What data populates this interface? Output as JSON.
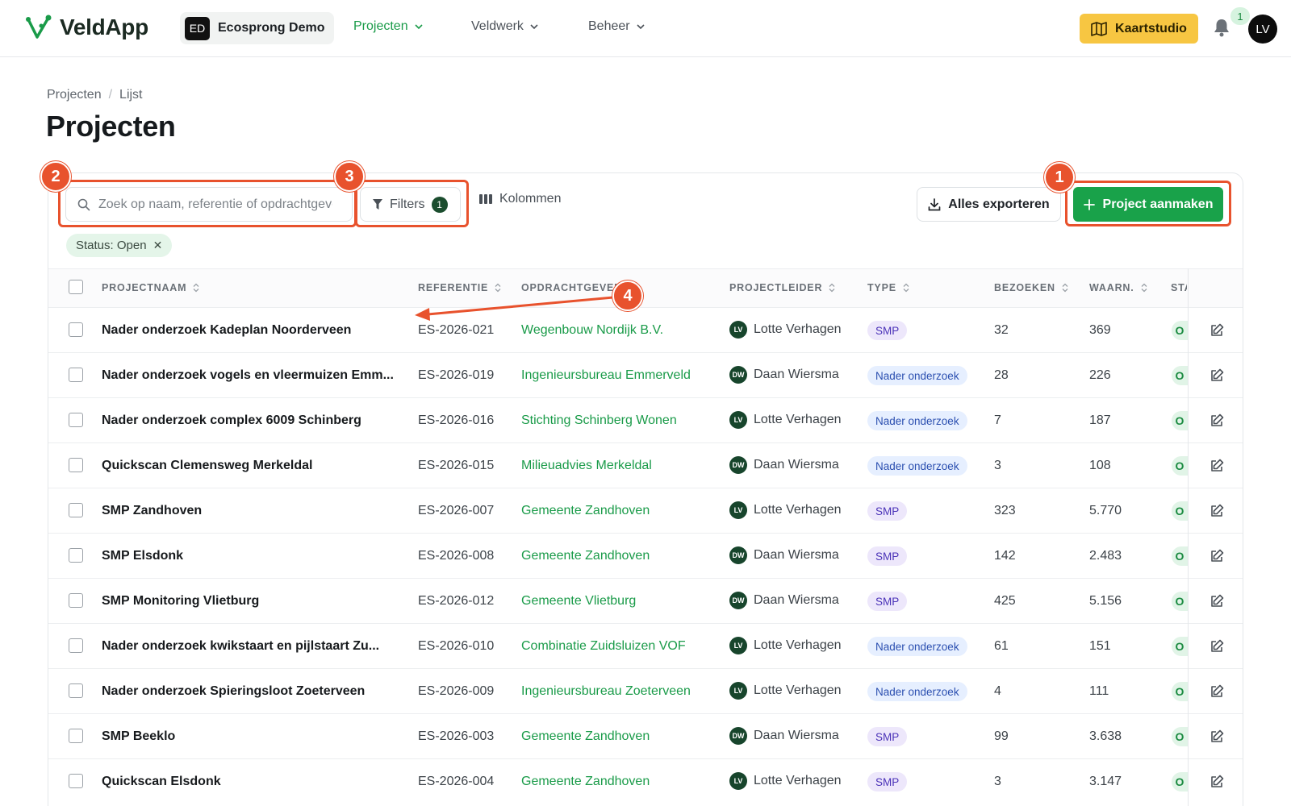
{
  "app": {
    "name": "VeldApp"
  },
  "org": {
    "initials": "ED",
    "name": "Ecosprong Demo"
  },
  "nav": [
    {
      "label": "Projecten",
      "active": true
    },
    {
      "label": "Veldwerk",
      "active": false
    },
    {
      "label": "Beheer",
      "active": false
    }
  ],
  "header_actions": {
    "map_label": "Kaartstudio",
    "notification_count": "1",
    "user_initials": "LV"
  },
  "breadcrumb": [
    "Projecten",
    "Lijst"
  ],
  "page_title": "Projecten",
  "toolbar": {
    "search_placeholder": "Zoek op naam, referentie of opdrachtgever",
    "filters_label": "Filters",
    "filters_count": "1",
    "columns_label": "Kolommen",
    "export_label": "Alles exporteren",
    "create_label": "Project aanmaken"
  },
  "active_filter": {
    "label": "Status: Open"
  },
  "table": {
    "headers": [
      "PROJECTNAAM",
      "REFERENTIE",
      "OPDRACHTGEVER",
      "PROJECTLEIDER",
      "TYPE",
      "BEZOEKEN",
      "WAARN.",
      "STA"
    ],
    "rows": [
      {
        "name": "Nader onderzoek Kadeplan Noorderveen",
        "ref": "ES-2026-021",
        "client": "Wegenbouw Nordijk B.V.",
        "lead_initials": "LV",
        "lead": "Lotte Verhagen",
        "type": "SMP",
        "visits": "32",
        "obs": "369",
        "status": "O"
      },
      {
        "name": "Nader onderzoek vogels en vleermuizen Emm...",
        "ref": "ES-2026-019",
        "client": "Ingenieursbureau Emmerveld",
        "lead_initials": "DW",
        "lead": "Daan Wiersma",
        "type": "Nader onderzoek",
        "visits": "28",
        "obs": "226",
        "status": "O"
      },
      {
        "name": "Nader onderzoek complex 6009 Schinberg",
        "ref": "ES-2026-016",
        "client": "Stichting Schinberg Wonen",
        "lead_initials": "LV",
        "lead": "Lotte Verhagen",
        "type": "Nader onderzoek",
        "visits": "7",
        "obs": "187",
        "status": "O"
      },
      {
        "name": "Quickscan Clemensweg Merkeldal",
        "ref": "ES-2026-015",
        "client": "Milieuadvies Merkeldal",
        "lead_initials": "DW",
        "lead": "Daan Wiersma",
        "type": "Nader onderzoek",
        "visits": "3",
        "obs": "108",
        "status": "O"
      },
      {
        "name": "SMP Zandhoven",
        "ref": "ES-2026-007",
        "client": "Gemeente Zandhoven",
        "lead_initials": "LV",
        "lead": "Lotte Verhagen",
        "type": "SMP",
        "visits": "323",
        "obs": "5.770",
        "status": "O"
      },
      {
        "name": "SMP Elsdonk",
        "ref": "ES-2026-008",
        "client": "Gemeente Zandhoven",
        "lead_initials": "DW",
        "lead": "Daan Wiersma",
        "type": "SMP",
        "visits": "142",
        "obs": "2.483",
        "status": "O"
      },
      {
        "name": "SMP Monitoring Vlietburg",
        "ref": "ES-2026-012",
        "client": "Gemeente Vlietburg",
        "lead_initials": "DW",
        "lead": "Daan Wiersma",
        "type": "SMP",
        "visits": "425",
        "obs": "5.156",
        "status": "O"
      },
      {
        "name": "Nader onderzoek kwikstaart en pijlstaart Zu...",
        "ref": "ES-2026-010",
        "client": "Combinatie Zuidsluizen VOF",
        "lead_initials": "LV",
        "lead": "Lotte Verhagen",
        "type": "Nader onderzoek",
        "visits": "61",
        "obs": "151",
        "status": "O"
      },
      {
        "name": "Nader onderzoek Spieringsloot Zoeterveen",
        "ref": "ES-2026-009",
        "client": "Ingenieursbureau Zoeterveen",
        "lead_initials": "LV",
        "lead": "Lotte Verhagen",
        "type": "Nader onderzoek",
        "visits": "4",
        "obs": "111",
        "status": "O"
      },
      {
        "name": "SMP Beeklo",
        "ref": "ES-2026-003",
        "client": "Gemeente Zandhoven",
        "lead_initials": "DW",
        "lead": "Daan Wiersma",
        "type": "SMP",
        "visits": "99",
        "obs": "3.638",
        "status": "O"
      },
      {
        "name": "Quickscan Elsdonk",
        "ref": "ES-2026-004",
        "client": "Gemeente Zandhoven",
        "lead_initials": "LV",
        "lead": "Lotte Verhagen",
        "type": "SMP",
        "visits": "3",
        "obs": "3.147",
        "status": "O"
      }
    ]
  },
  "annotations": [
    "1",
    "2",
    "3",
    "4"
  ],
  "colors": {
    "brand_green": "#1a9b49",
    "accent_yellow": "#f7c642",
    "annotation": "#e8522d"
  }
}
